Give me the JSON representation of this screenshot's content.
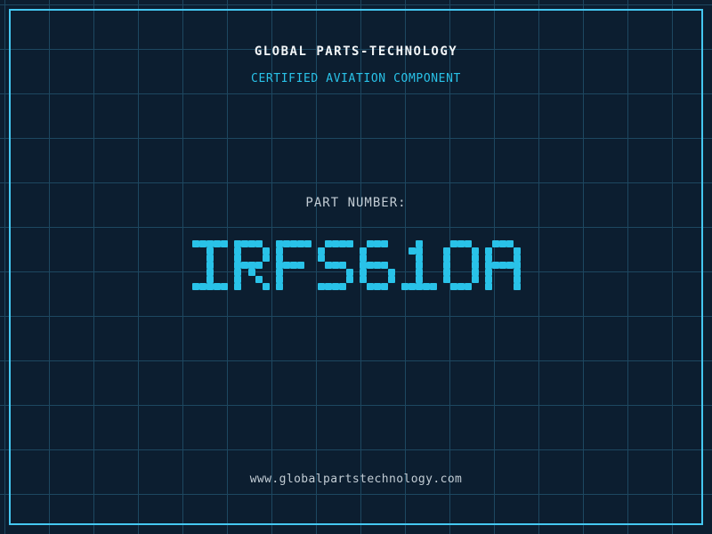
{
  "header": {
    "company": "GLOBAL PARTS-TECHNOLOGY",
    "tagline": "CERTIFIED AVIATION COMPONENT"
  },
  "part": {
    "label": "PART NUMBER:",
    "number": "IRFS610A"
  },
  "footer": {
    "website": "www.globalpartstechnology.com"
  },
  "colors": {
    "background": "#0c1e30",
    "grid_line": "#1d4760",
    "border": "#45c8f1",
    "accent_cyan": "#29c2e8",
    "title_white": "#f2f5f7",
    "label_gray": "#c2ccd4"
  }
}
